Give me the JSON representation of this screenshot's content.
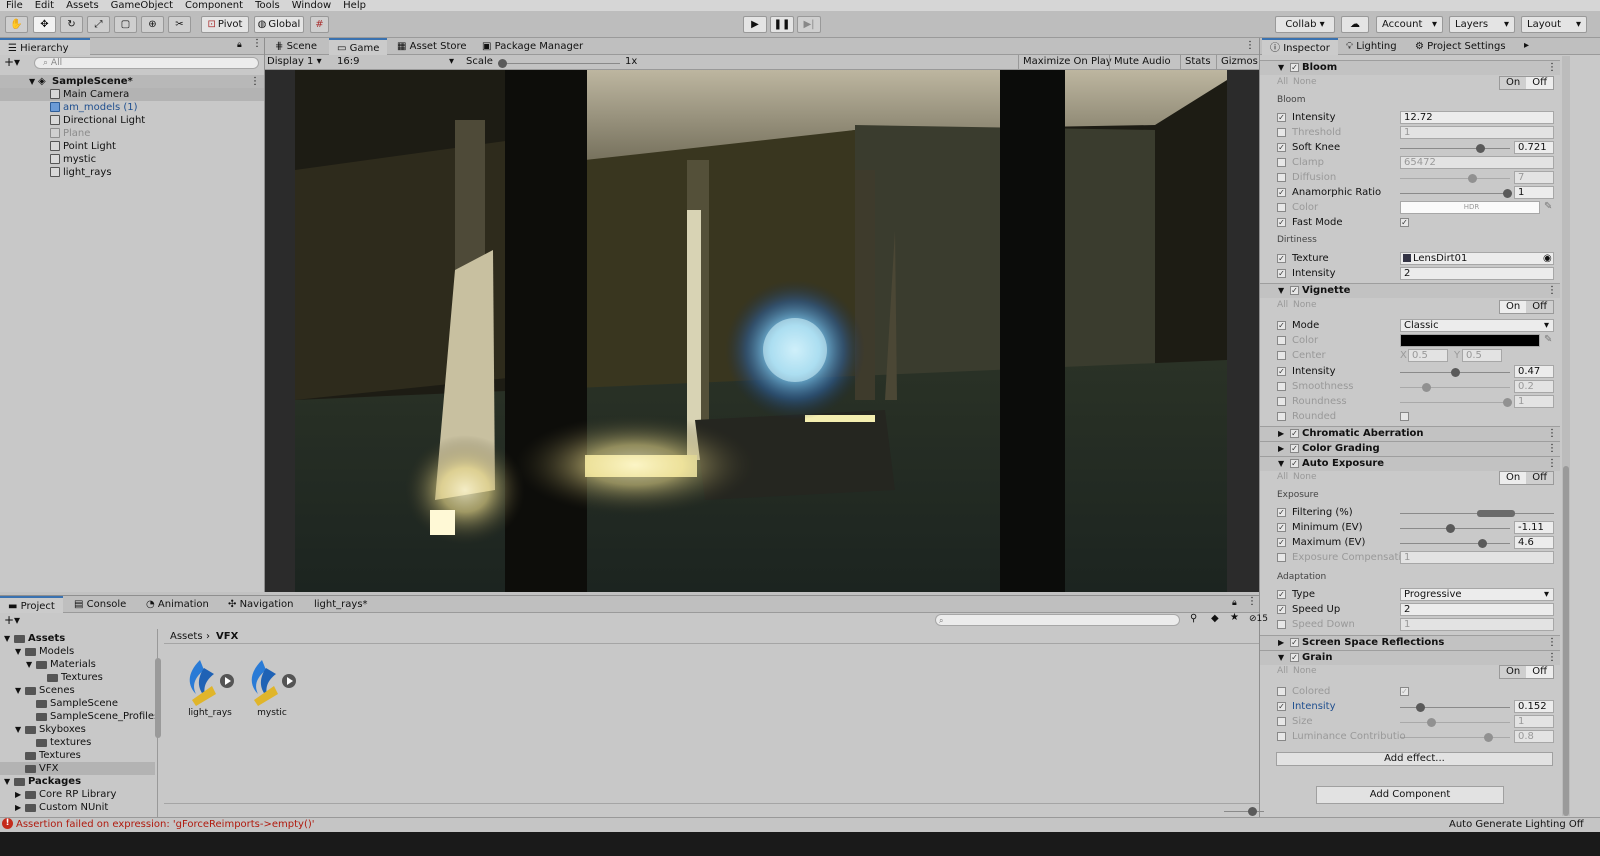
{
  "menu": [
    "File",
    "Edit",
    "Assets",
    "GameObject",
    "Component",
    "Tools",
    "Window",
    "Help"
  ],
  "toolbar": {
    "pivot": "Pivot",
    "global": "Global",
    "collab": "Collab ▾",
    "account": "Account",
    "layers": "Layers",
    "layout": "Layout"
  },
  "hierarchy": {
    "tab": "Hierarchy",
    "search_placeholder": "All",
    "scene": "SampleScene*",
    "items": [
      "Main Camera",
      "am_models (1)",
      "Directional Light",
      "Plane",
      "Point Light",
      "mystic",
      "light_rays"
    ]
  },
  "center_tabs": [
    "Scene",
    "Game",
    "Asset Store",
    "Package Manager"
  ],
  "game_bar": {
    "display": "Display 1",
    "aspect": "16:9",
    "scale_label": "Scale",
    "scale_value": "1x",
    "maximize": "Maximize On Play",
    "mute": "Mute Audio",
    "stats": "Stats",
    "gizmos": "Gizmos"
  },
  "inspector_tabs": [
    "Inspector",
    "Lighting",
    "Project Settings"
  ],
  "bloom": {
    "title": "Bloom",
    "all": "All",
    "none": "None",
    "on": "On",
    "off": "Off",
    "group": "Bloom",
    "intensity_label": "Intensity",
    "intensity": "12.72",
    "threshold_label": "Threshold",
    "threshold": "1",
    "softknee_label": "Soft Knee",
    "softknee": "0.721",
    "clamp_label": "Clamp",
    "clamp": "65472",
    "diffusion_label": "Diffusion",
    "diffusion": "7",
    "anamorphic_label": "Anamorphic Ratio",
    "anamorphic": "1",
    "color_label": "Color",
    "color_tag": "HDR",
    "fastmode_label": "Fast Mode",
    "dirt_group": "Dirtiness",
    "texture_label": "Texture",
    "texture": "LensDirt01",
    "dirt_intensity_label": "Intensity",
    "dirt_intensity": "2"
  },
  "vignette": {
    "title": "Vignette",
    "all": "All",
    "none": "None",
    "on": "On",
    "off": "Off",
    "mode_label": "Mode",
    "mode": "Classic",
    "color_label": "Color",
    "center_label": "Center",
    "cx_label": "X",
    "cx": "0.5",
    "cy_label": "Y",
    "cy": "0.5",
    "intensity_label": "Intensity",
    "intensity": "0.47",
    "smoothness_label": "Smoothness",
    "smoothness": "0.2",
    "roundness_label": "Roundness",
    "roundness": "1",
    "rounded_label": "Rounded"
  },
  "chromatic": "Chromatic Aberration",
  "colorgrading": "Color Grading",
  "autoexposure": {
    "title": "Auto Exposure",
    "all": "All",
    "none": "None",
    "on": "On",
    "off": "Off",
    "exposure_group": "Exposure",
    "filtering_label": "Filtering (%)",
    "min_label": "Minimum (EV)",
    "min": "-1.11",
    "max_label": "Maximum (EV)",
    "max": "4.6",
    "comp_label": "Exposure Compensatio",
    "comp": "1",
    "adapt_group": "Adaptation",
    "type_label": "Type",
    "type": "Progressive",
    "speedup_label": "Speed Up",
    "speedup": "2",
    "speeddown_label": "Speed Down",
    "speeddown": "1"
  },
  "ssr": "Screen Space Reflections",
  "grain": {
    "title": "Grain",
    "all": "All",
    "none": "None",
    "on": "On",
    "off": "Off",
    "colored_label": "Colored",
    "intensity_label": "Intensity",
    "intensity": "0.152",
    "size_label": "Size",
    "size": "1",
    "lum_label": "Luminance Contributio",
    "lum": "0.8"
  },
  "add_effect": "Add effect...",
  "add_component": "Add Component",
  "project": {
    "tabs": [
      "Project",
      "Console",
      "Animation",
      "Navigation",
      "light_rays*"
    ],
    "count": "15",
    "breadcrumb": [
      "Assets",
      "VFX"
    ],
    "tree": [
      {
        "label": "Assets",
        "indent": 0,
        "bold": true
      },
      {
        "label": "Models",
        "indent": 1
      },
      {
        "label": "Materials",
        "indent": 2
      },
      {
        "label": "Textures",
        "indent": 3
      },
      {
        "label": "Scenes",
        "indent": 1
      },
      {
        "label": "SampleScene",
        "indent": 2
      },
      {
        "label": "SampleScene_Profiles",
        "indent": 2
      },
      {
        "label": "Skyboxes",
        "indent": 1
      },
      {
        "label": "textures",
        "indent": 2
      },
      {
        "label": "Textures",
        "indent": 1
      },
      {
        "label": "VFX",
        "indent": 1
      },
      {
        "label": "Packages",
        "indent": 0,
        "bold": true
      },
      {
        "label": "Core RP Library",
        "indent": 1
      },
      {
        "label": "Custom NUnit",
        "indent": 1
      }
    ],
    "assets": [
      "light_rays",
      "mystic"
    ]
  },
  "status": {
    "error": "Assertion failed on expression: 'gForceReimports->empty()'",
    "right": "Auto Generate Lighting Off"
  }
}
